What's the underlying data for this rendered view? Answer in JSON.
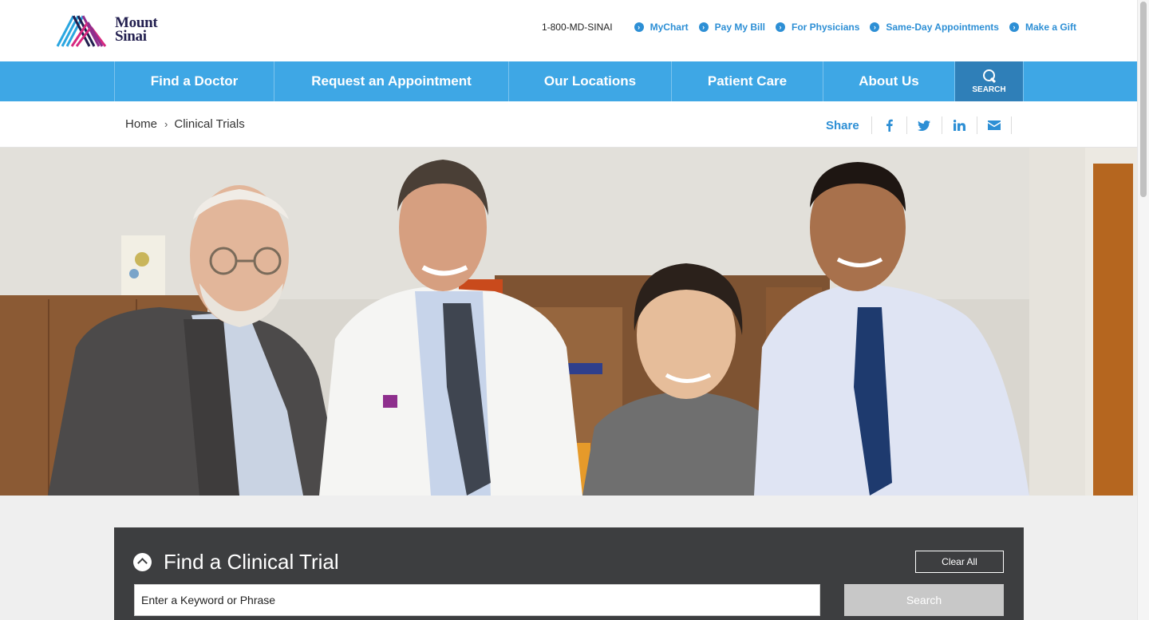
{
  "brand": {
    "name_line1": "Mount",
    "name_line2": "Sinai"
  },
  "utility": {
    "phone": "1-800-MD-SINAI",
    "links": [
      "MyChart",
      "Pay My Bill",
      "For Physicians",
      "Same-Day Appointments",
      "Make a Gift"
    ]
  },
  "nav": {
    "items": [
      "Find a Doctor",
      "Request an Appointment",
      "Our Locations",
      "Patient Care",
      "About Us"
    ],
    "search_label": "SEARCH"
  },
  "breadcrumb": {
    "home": "Home",
    "current": "Clinical Trials"
  },
  "share": {
    "label": "Share",
    "icons": [
      "facebook-icon",
      "twitter-icon",
      "linkedin-icon",
      "email-icon"
    ]
  },
  "trial_search": {
    "title": "Find a Clinical Trial",
    "clear_label": "Clear All",
    "keyword_value": "Enter a Keyword or Phrase",
    "search_label": "Search"
  },
  "colors": {
    "nav_blue": "#3ea7e5",
    "nav_search_blue": "#2f7fb8",
    "link_blue": "#2d8fd5",
    "panel_dark": "#3d3e40",
    "brand_navy": "#221f4f"
  }
}
